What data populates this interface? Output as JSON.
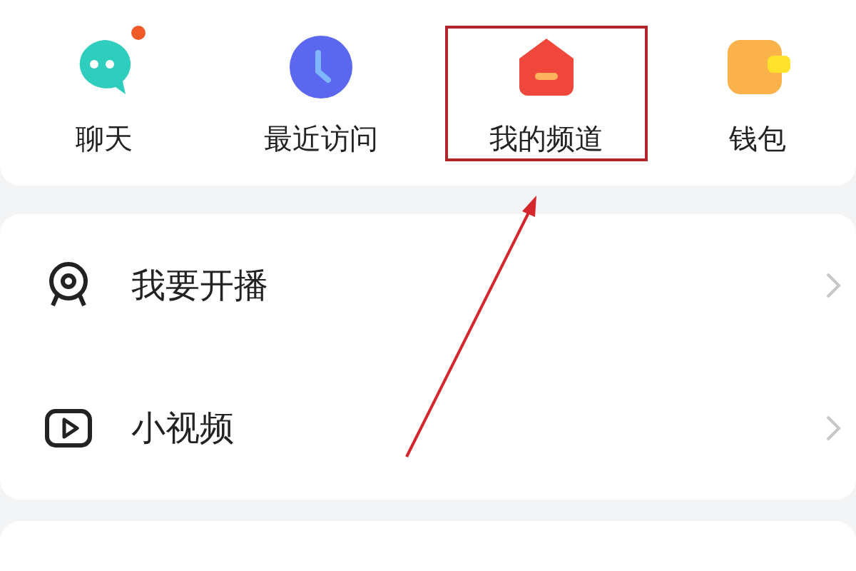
{
  "shortcuts": [
    {
      "kind": "chat",
      "label": "聊天",
      "badge": true,
      "highlighted": false
    },
    {
      "kind": "clock",
      "label": "最近访问",
      "badge": false,
      "highlighted": false
    },
    {
      "kind": "channel",
      "label": "我的频道",
      "badge": false,
      "highlighted": true
    },
    {
      "kind": "wallet",
      "label": "钱包",
      "badge": false,
      "highlighted": false
    }
  ],
  "menu": [
    {
      "kind": "webcam",
      "label": "我要开播"
    },
    {
      "kind": "video",
      "label": "小视频"
    }
  ]
}
